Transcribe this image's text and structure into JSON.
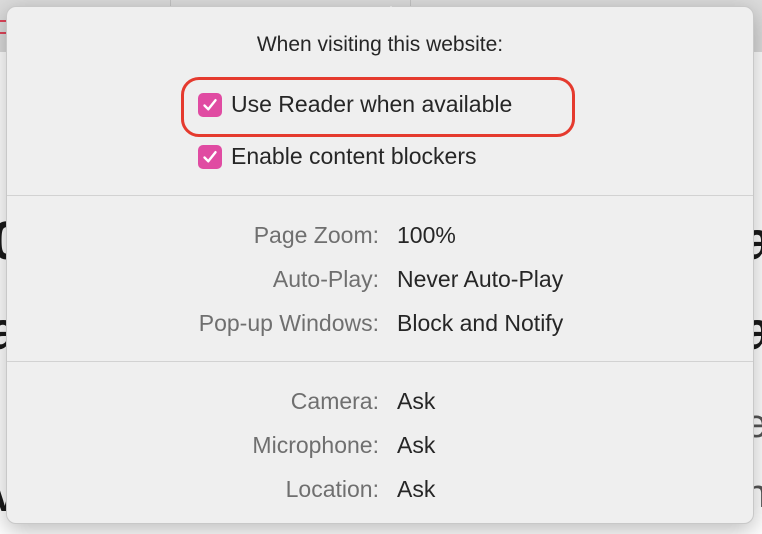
{
  "popover": {
    "title": "When visiting this website:",
    "checkboxes": [
      {
        "label": "Use Reader when available",
        "checked": true,
        "highlighted": true
      },
      {
        "label": "Enable content blockers",
        "checked": true,
        "highlighted": false
      }
    ],
    "settings_general": [
      {
        "label": "Page Zoom:",
        "value": "100%"
      },
      {
        "label": "Auto-Play:",
        "value": "Never Auto-Play"
      },
      {
        "label": "Pop-up Windows:",
        "value": "Block and Notify"
      }
    ],
    "settings_permissions": [
      {
        "label": "Camera:",
        "value": "Ask"
      },
      {
        "label": "Microphone:",
        "value": "Ask"
      },
      {
        "label": "Location:",
        "value": "Ask"
      }
    ]
  },
  "colors": {
    "checkbox_accent": "#e04ba2",
    "highlight_ring": "#e53a2e",
    "popover_bg": "#efefef"
  },
  "icons": {
    "checkbox_mark": "checkmark-icon"
  }
}
